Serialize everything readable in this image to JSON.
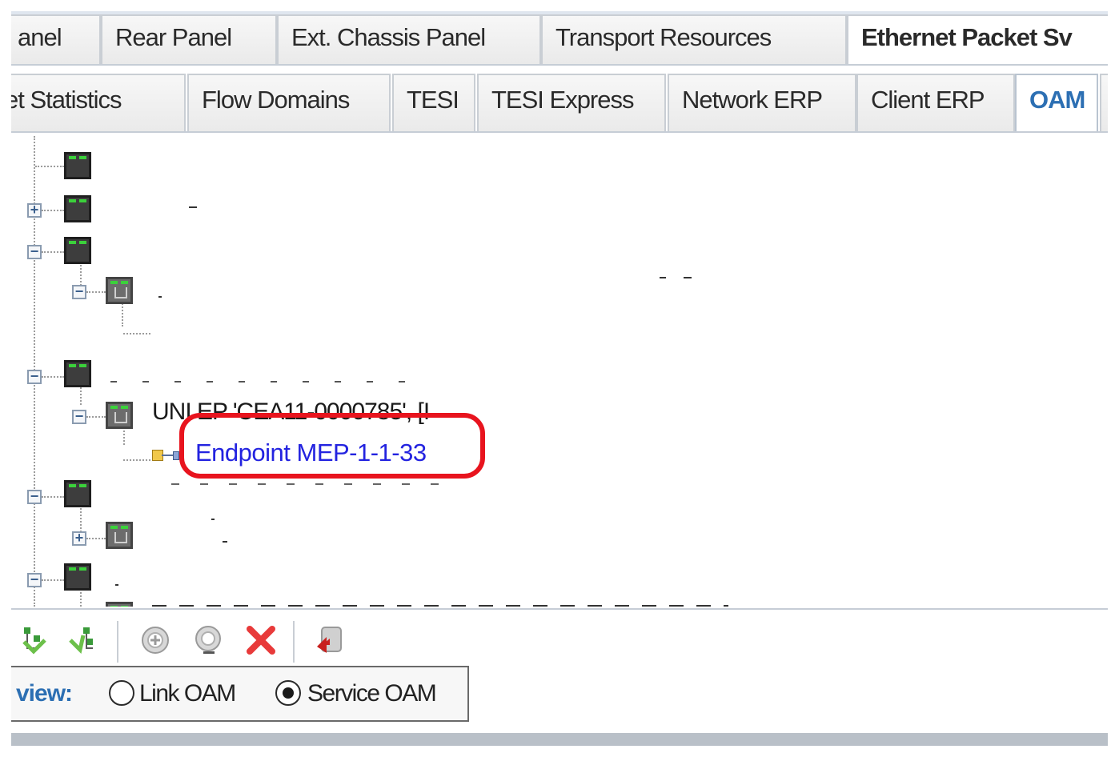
{
  "tabs_row1": [
    {
      "label": "anel",
      "active": false
    },
    {
      "label": "Rear Panel",
      "active": false
    },
    {
      "label": "Ext. Chassis Panel",
      "active": false
    },
    {
      "label": "Transport Resources",
      "active": false
    },
    {
      "label": "Ethernet Packet Sv",
      "active": true
    }
  ],
  "tabs_row2": [
    {
      "label": "et Statistics",
      "active": false
    },
    {
      "label": "Flow Domains",
      "active": false
    },
    {
      "label": "TESI",
      "active": false
    },
    {
      "label": "TESI Express",
      "active": false
    },
    {
      "label": "Network ERP",
      "active": false
    },
    {
      "label": "Client ERP",
      "active": false
    },
    {
      "label": "OAM",
      "active": true
    }
  ],
  "tree": {
    "uni_ep_label": "UNI EP 'CEA11-0000785', [I",
    "endpoint_label": "Endpoint MEP-1-1-33",
    "expander_plus": "+",
    "expander_minus": "−"
  },
  "toolbar": {
    "icons": [
      "add-ma-icon",
      "add-mep-icon",
      "add-icon",
      "edit-icon",
      "delete-icon",
      "export-icon"
    ]
  },
  "view": {
    "label": "view:",
    "options": [
      {
        "label": "Link OAM",
        "selected": false
      },
      {
        "label": "Service OAM",
        "selected": true
      }
    ]
  },
  "colors": {
    "accent_blue": "#2c6fb3",
    "mep_link": "#2323e0",
    "highlight_red": "#e8141e",
    "status_green": "#3bd13b"
  }
}
